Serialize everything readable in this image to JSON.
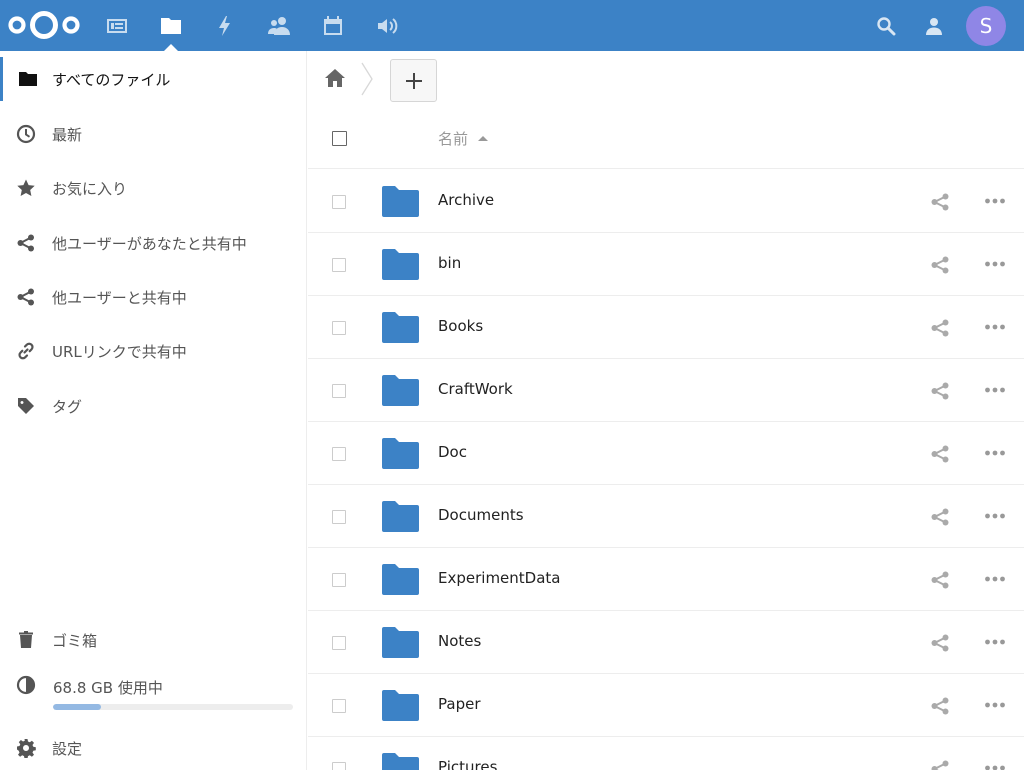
{
  "header": {
    "apps": [
      {
        "name": "dashboard",
        "icon": "dashboard-icon"
      },
      {
        "name": "files",
        "icon": "folder-icon",
        "active": true
      },
      {
        "name": "activity",
        "icon": "lightning-icon"
      },
      {
        "name": "contacts",
        "icon": "contacts-icon"
      },
      {
        "name": "calendar",
        "icon": "calendar-icon"
      },
      {
        "name": "talk",
        "icon": "speaker-icon"
      }
    ],
    "avatar_initial": "S",
    "brand_color": "#3c82c6",
    "avatar_color": "#8f86e6"
  },
  "sidebar": {
    "items": [
      {
        "label": "すべてのファイル",
        "icon": "folder-icon",
        "active": true
      },
      {
        "label": "最新",
        "icon": "clock-icon"
      },
      {
        "label": "お気に入り",
        "icon": "star-icon"
      },
      {
        "label": "他ユーザーがあなたと共有中",
        "icon": "share-icon"
      },
      {
        "label": "他ユーザーと共有中",
        "icon": "share-icon"
      },
      {
        "label": "URLリンクで共有中",
        "icon": "link-icon"
      },
      {
        "label": "タグ",
        "icon": "tag-icon"
      }
    ],
    "trash_label": "ゴミ箱",
    "quota_label": "68.8 GB 使用中",
    "quota_fraction": 0.2,
    "settings_label": "設定"
  },
  "table": {
    "name_header": "名前",
    "files": [
      {
        "name": "Archive"
      },
      {
        "name": "bin"
      },
      {
        "name": "Books"
      },
      {
        "name": "CraftWork"
      },
      {
        "name": "Doc"
      },
      {
        "name": "Documents"
      },
      {
        "name": "ExperimentData"
      },
      {
        "name": "Notes"
      },
      {
        "name": "Paper"
      },
      {
        "name": "Pictures"
      }
    ]
  }
}
